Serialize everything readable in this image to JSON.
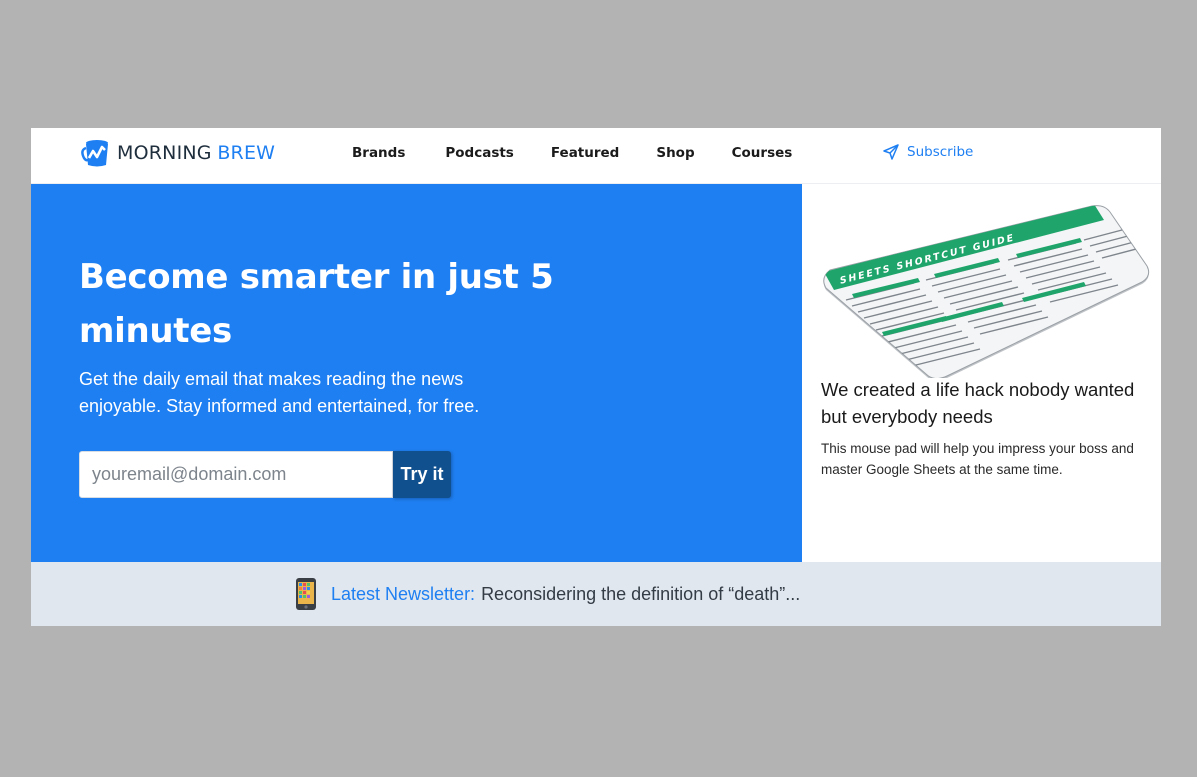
{
  "brand": {
    "name_part1": "Morning",
    "name_part2": "Brew",
    "accent_color": "#1e7ff2",
    "hero_bg": "#1e7ff2",
    "button_color": "#11508f",
    "newsbar_bg": "#e1e7ee"
  },
  "nav": {
    "links": [
      "Brands",
      "Podcasts",
      "Featured",
      "Shop",
      "Courses"
    ],
    "subscribe_label": "Subscribe",
    "subscribe_icon": "paper-plane-icon"
  },
  "hero": {
    "title": "Become smarter in just 5 minutes",
    "subtitle": "Get the daily email that makes reading the news enjoyable. Stay informed and entertained, for free.",
    "email_placeholder": "youremail@domain.com",
    "email_value": "",
    "button_label": "Try it"
  },
  "promo": {
    "image_label": "SHEETS SHORTCUT GUIDE",
    "title": "We created a life hack nobody wanted but everybody needs",
    "description": "This mouse pad will help you impress your boss and master Google Sheets at the same time."
  },
  "newsletter": {
    "icon": "mobile-phone-icon",
    "label": "Latest Newsletter:",
    "text": "Reconsidering the definition of “death”..."
  }
}
